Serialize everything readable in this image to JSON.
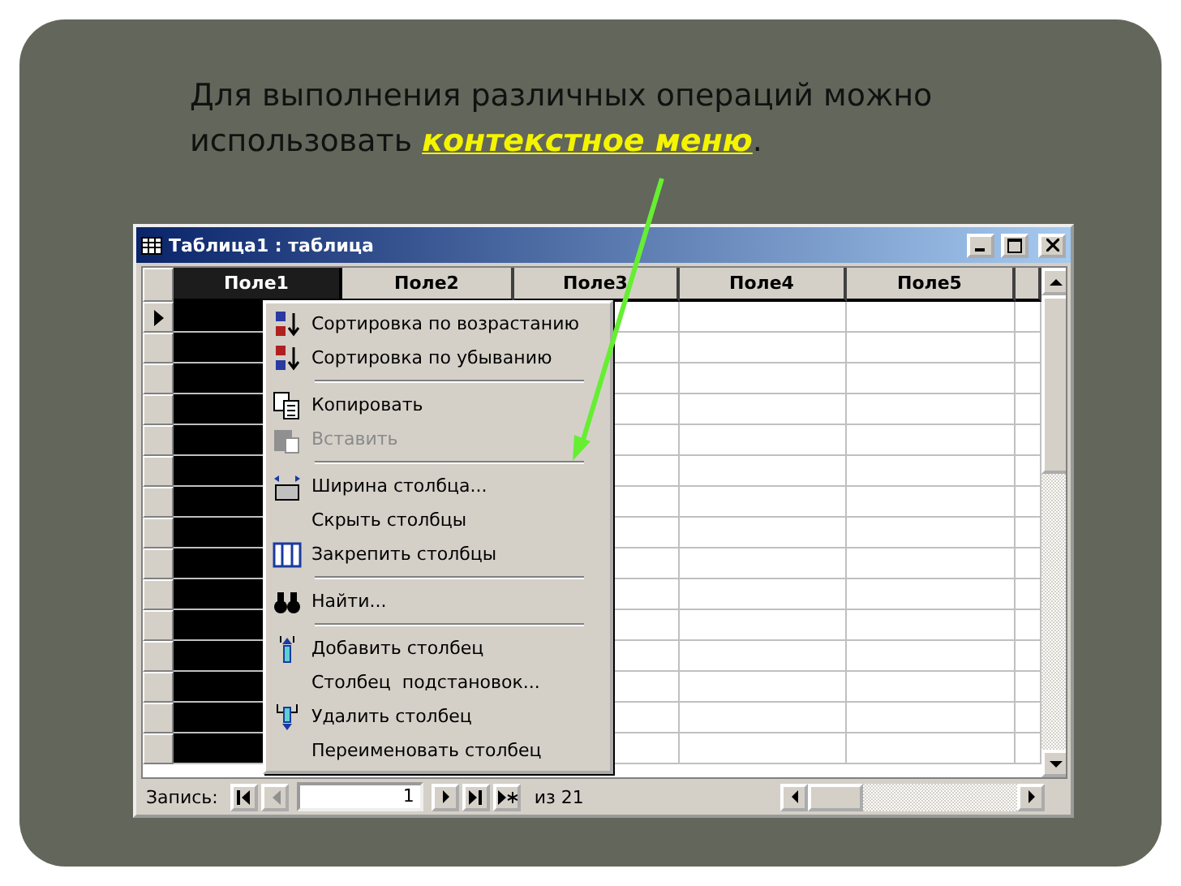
{
  "slide": {
    "text_before": "Для выполнения различных операций можно использовать ",
    "highlight": "контекстное меню",
    "text_after": "."
  },
  "window": {
    "title": "Таблица1 : таблица"
  },
  "table": {
    "columns": [
      {
        "label": "Поле1",
        "selected": true
      },
      {
        "label": "Поле2",
        "selected": false
      },
      {
        "label": "Поле3",
        "selected": false
      },
      {
        "label": "Поле4",
        "selected": false
      },
      {
        "label": "Поле5",
        "selected": false
      }
    ],
    "rows": [
      {
        "current": true
      },
      {
        "current": false
      },
      {
        "current": false
      },
      {
        "current": false
      },
      {
        "current": false
      },
      {
        "current": false
      },
      {
        "current": false
      },
      {
        "current": false
      },
      {
        "current": false
      },
      {
        "current": false
      },
      {
        "current": false
      },
      {
        "current": false
      },
      {
        "current": false
      },
      {
        "current": false
      },
      {
        "current": false
      }
    ]
  },
  "context_menu": [
    {
      "kind": "item",
      "label": "Сортировка по возрастанию",
      "disabled": false
    },
    {
      "kind": "item",
      "label": "Сортировка по убыванию",
      "disabled": false
    },
    {
      "kind": "separator"
    },
    {
      "kind": "item",
      "label": "Копировать",
      "disabled": false
    },
    {
      "kind": "item",
      "label": "Вставить",
      "disabled": true
    },
    {
      "kind": "separator"
    },
    {
      "kind": "item",
      "label": "Ширина столбца...",
      "disabled": false
    },
    {
      "kind": "item",
      "label": "Скрыть столбцы",
      "disabled": false
    },
    {
      "kind": "item",
      "label": "Закрепить столбцы",
      "disabled": false
    },
    {
      "kind": "separator"
    },
    {
      "kind": "item",
      "label": "Найти...",
      "disabled": false
    },
    {
      "kind": "separator"
    },
    {
      "kind": "item",
      "label": "Добавить столбец",
      "disabled": false
    },
    {
      "kind": "item",
      "label": "Столбец  подстановок...",
      "disabled": false
    },
    {
      "kind": "item",
      "label": "Удалить столбец",
      "disabled": false
    },
    {
      "kind": "item",
      "label": "Переименовать столбец",
      "disabled": false
    }
  ],
  "status_bar": {
    "label": "Запись:",
    "record": "1",
    "total": "из 21"
  }
}
